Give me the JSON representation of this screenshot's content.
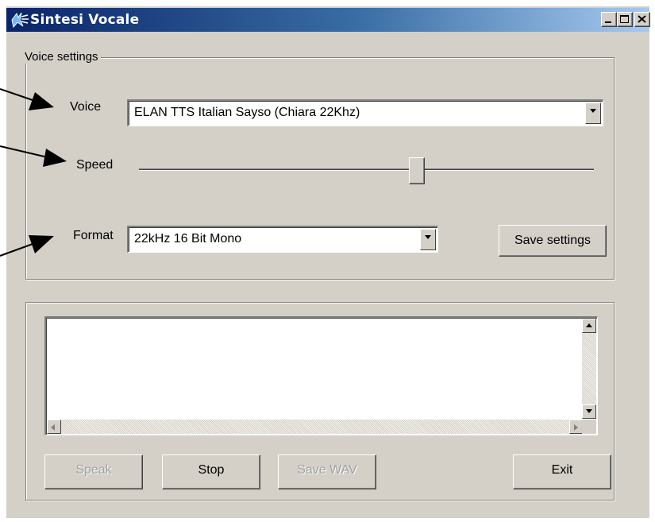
{
  "window": {
    "title": "Sintesi Vocale",
    "controls": [
      "minimize-icon",
      "maximize-icon",
      "close-icon"
    ],
    "title_gradient": [
      "#0a246a",
      "#a6caf0"
    ],
    "background": "#d4d0c8"
  },
  "voice_settings": {
    "legend": "Voice settings",
    "voice_label": "Voice",
    "voice_value": "ELAN TTS Italian Sayso (Chiara 22Khz)",
    "speed_label": "Speed",
    "speed_level_fraction": 0.61,
    "format_label": "Format",
    "format_value": "22kHz 16 Bit Mono",
    "save_settings_label": "Save settings"
  },
  "text_panel": {
    "text": ""
  },
  "buttons": {
    "speak": {
      "label": "Speak",
      "enabled": false
    },
    "stop": {
      "label": "Stop",
      "enabled": true
    },
    "save_wav": {
      "label": "Save WAV",
      "enabled": false
    },
    "exit": {
      "label": "Exit",
      "enabled": true
    }
  },
  "annotations": {
    "arrow_icon": "arrow-pointer-icon",
    "color": "#000000"
  }
}
